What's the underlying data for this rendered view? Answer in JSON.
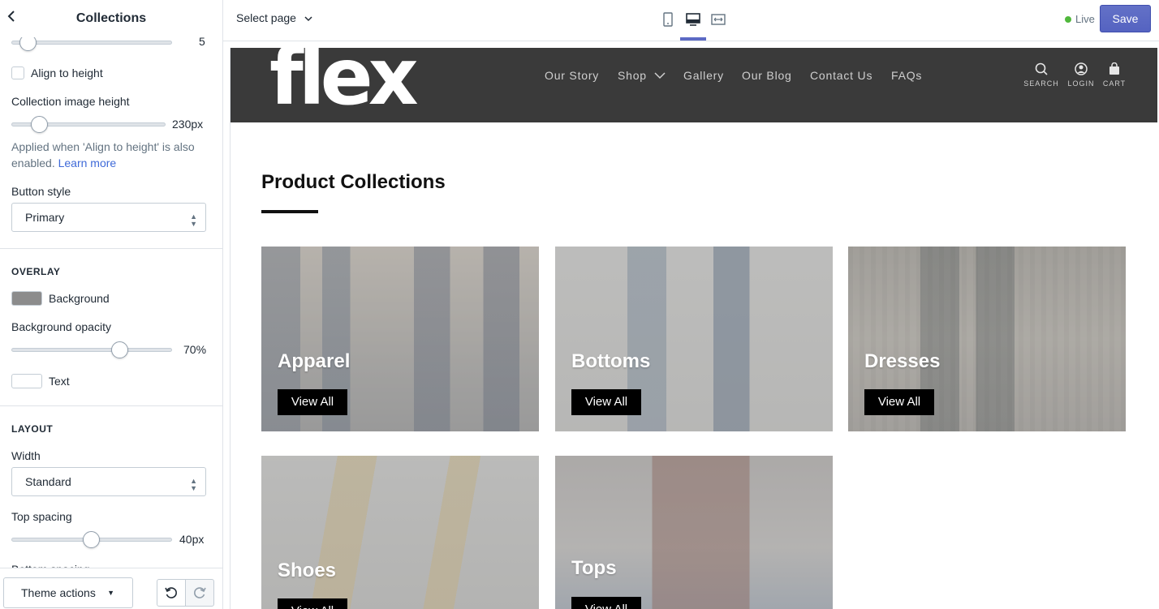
{
  "sidebar": {
    "title": "Collections",
    "top_slider_value": "5",
    "align_to_height_label": "Align to height",
    "image_height_label": "Collection image height",
    "image_height_value": "230px",
    "help_text": "Applied when 'Align to height' is also enabled.",
    "help_link": "Learn more",
    "button_style_label": "Button style",
    "button_style_value": "Primary",
    "overlay_heading": "OVERLAY",
    "background_label": "Background",
    "background_color": "#8c8c8c",
    "opacity_label": "Background opacity",
    "opacity_value": "70%",
    "opacity_fraction": 0.7,
    "text_label": "Text",
    "text_color": "#ffffff",
    "layout_heading": "LAYOUT",
    "width_label": "Width",
    "width_value": "Standard",
    "top_spacing_label": "Top spacing",
    "top_spacing_value": "40px",
    "bottom_spacing_label_partial": "Bottom spacing",
    "theme_actions_label": "Theme actions"
  },
  "topbar": {
    "select_page": "Select page",
    "live_label": "Live",
    "save_label": "Save",
    "accent": "#5c6ac4"
  },
  "store": {
    "logo": "flex",
    "nav": [
      "Our Story",
      "Shop",
      "Gallery",
      "Our Blog",
      "Contact Us",
      "FAQs"
    ],
    "icons": {
      "search": "SEARCH",
      "login": "LOGIN",
      "cart": "CART"
    },
    "section_title": "Product Collections",
    "collections": [
      {
        "name": "Apparel",
        "button": "View All"
      },
      {
        "name": "Bottoms",
        "button": "View All"
      },
      {
        "name": "Dresses",
        "button": "View All"
      },
      {
        "name": "Shoes",
        "button": "View All"
      },
      {
        "name": "Tops",
        "button": "View All"
      }
    ]
  }
}
